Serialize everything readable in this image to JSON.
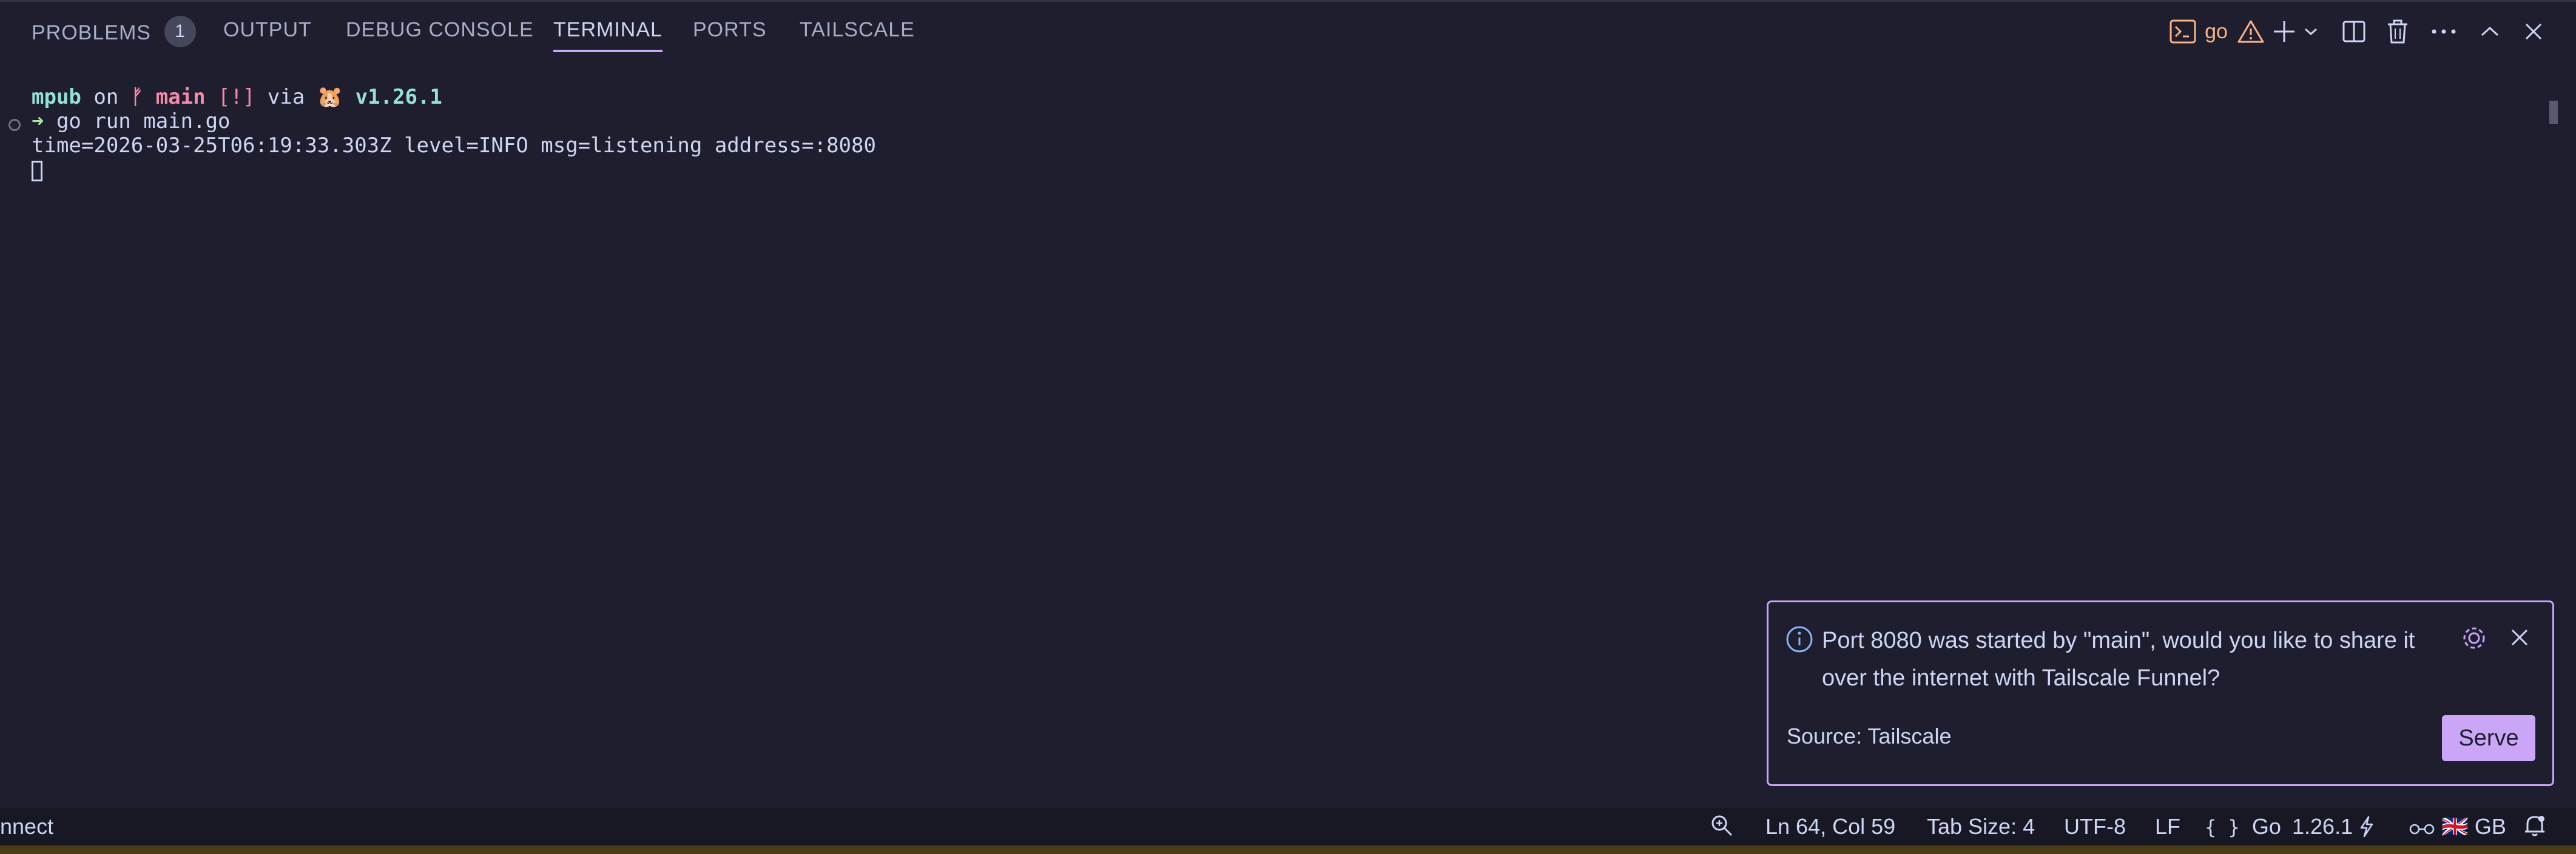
{
  "tabs": {
    "problems": "PROBLEMS",
    "problems_count": "1",
    "output": "OUTPUT",
    "debug_console": "DEBUG CONSOLE",
    "terminal": "TERMINAL",
    "ports": "PORTS",
    "tailscale": "TAILSCALE"
  },
  "actions": {
    "terminal_name": "go"
  },
  "terminal": {
    "prompt_dir": "mpub",
    "prompt_on": " on ",
    "prompt_branch_icon": "ᚠ",
    "prompt_branch": " main",
    "prompt_status": " [!]",
    "prompt_via": " via ",
    "prompt_go_icon": "🐹",
    "prompt_version": " v1.26.1",
    "arrow": "➜",
    "command": " go run main.go",
    "log_line": "time=2026-03-25T06:19:33.303Z level=INFO msg=listening address=:8080"
  },
  "notification": {
    "message": "Port 8080 was started by \"main\", would you like to share it over the internet with Tailscale Funnel?",
    "source": "Source: Tailscale",
    "serve_label": "Serve"
  },
  "statusbar": {
    "left_text": "nnect",
    "position": "Ln 64, Col 59",
    "tab_size": "Tab Size: 4",
    "encoding": "UTF-8",
    "eol": "LF",
    "language_braces": "{ }",
    "language": "Go",
    "go_version": "1.26.1",
    "locale_flag": "🇬🇧",
    "locale": "GB"
  },
  "colors": {
    "background": "#1e1e2e",
    "accent": "#cba6f7",
    "warning": "#fab387",
    "teal": "#94e2d5",
    "pink": "#f38ba8"
  }
}
